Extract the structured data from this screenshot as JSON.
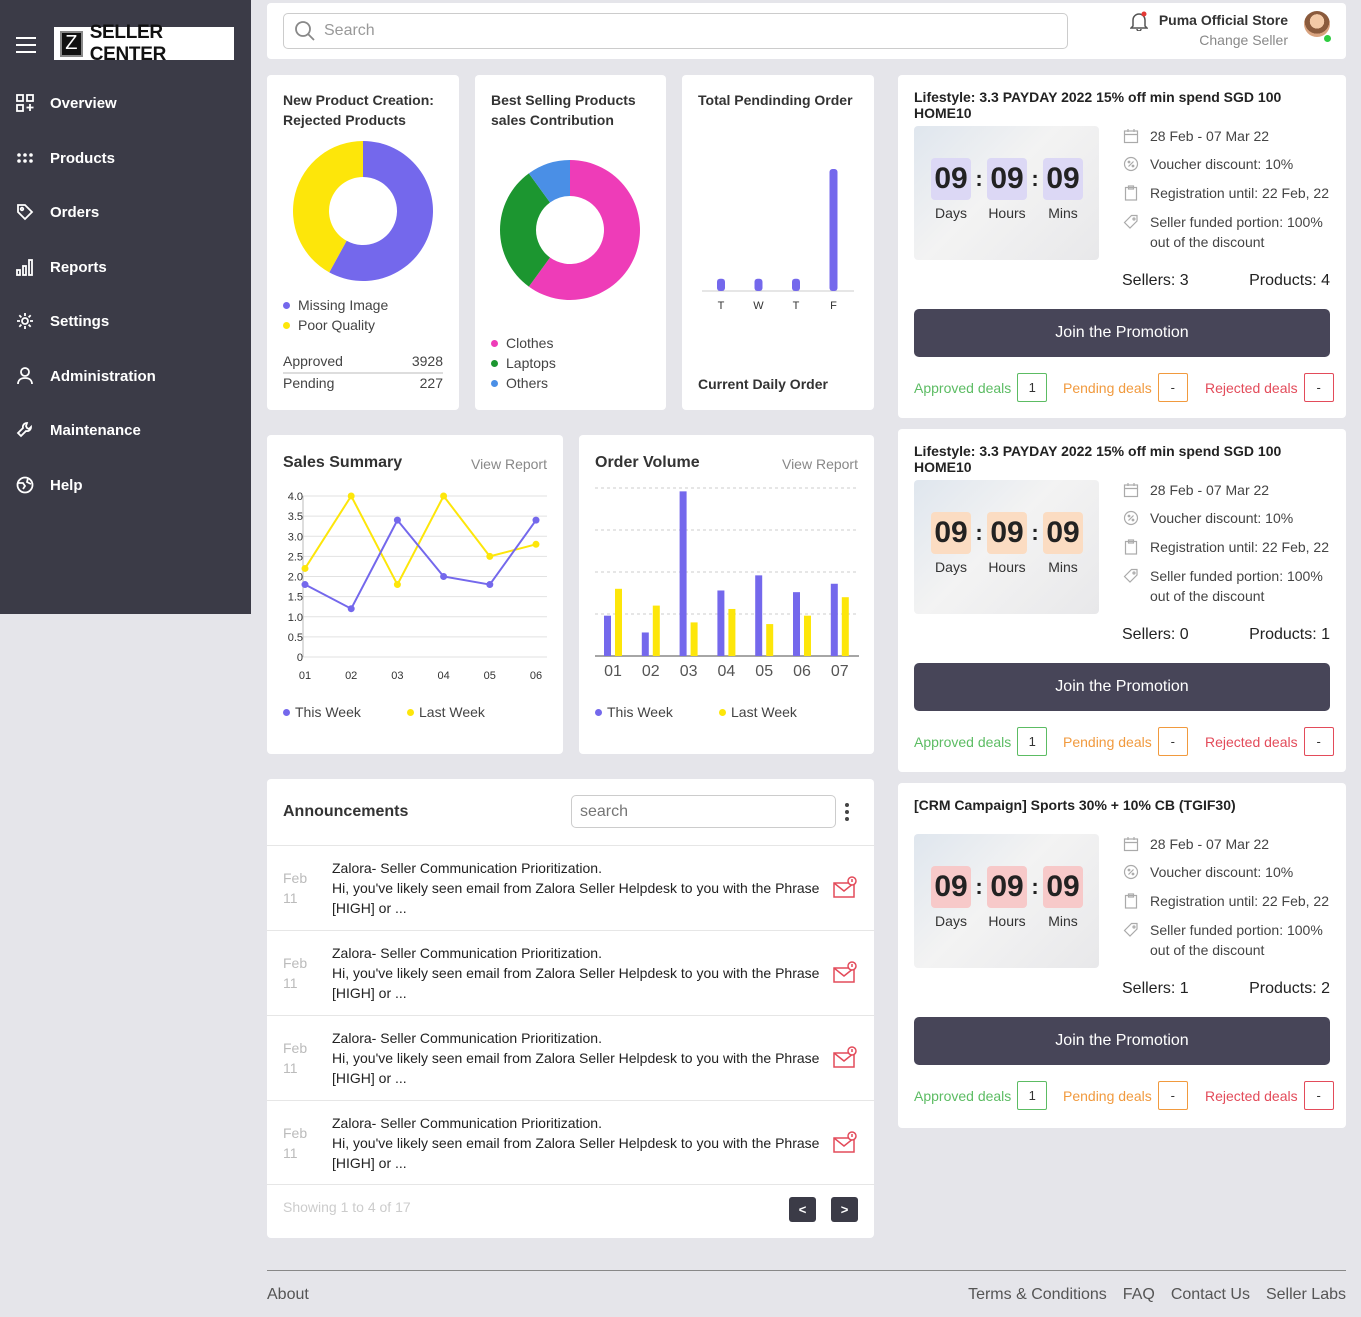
{
  "sidebar": {
    "logo_letter": "Z",
    "logo_text": "SELLER CENTER",
    "items": [
      {
        "label": "Overview",
        "icon": "grid-add-icon"
      },
      {
        "label": "Products",
        "icon": "dots-grid-icon"
      },
      {
        "label": "Orders",
        "icon": "tag-icon"
      },
      {
        "label": "Reports",
        "icon": "bar-chart-icon"
      },
      {
        "label": "Settings",
        "icon": "gear-icon"
      },
      {
        "label": "Administration",
        "icon": "user-icon"
      },
      {
        "label": "Maintenance",
        "icon": "wrench-icon"
      },
      {
        "label": "Help",
        "icon": "globe-icon"
      }
    ]
  },
  "header": {
    "search_placeholder": "Search",
    "store_name": "Puma Official Store",
    "change_seller": "Change Seller"
  },
  "cards": {
    "rejected": {
      "title_line1": "New Product Creation:",
      "title_line2": "Rejected Products",
      "legend": [
        "Missing Image",
        "Poor Quality"
      ],
      "approved_label": "Approved",
      "approved_value": "3928",
      "pending_label": "Pending",
      "pending_value": "227"
    },
    "best_selling": {
      "title_line1": "Best Selling Products",
      "title_line2": "sales Contribution",
      "legend": [
        "Clothes",
        "Laptops",
        "Others"
      ]
    },
    "pending_order": {
      "title": "Total Pendinding Order",
      "footer": "Current Daily Order"
    },
    "sales_summary": {
      "title": "Sales Summary",
      "link": "View Report"
    },
    "order_volume": {
      "title": "Order Volume",
      "link": "View Report"
    },
    "legend_this_week": "This Week",
    "legend_last_week": "Last Week"
  },
  "chart_data": [
    {
      "type": "pie",
      "categories": [
        "Missing Image",
        "Poor Quality"
      ],
      "values": [
        58,
        42
      ],
      "colors": [
        "#7468ec",
        "#fde60a"
      ]
    },
    {
      "type": "pie",
      "categories": [
        "Clothes",
        "Laptops",
        "Others"
      ],
      "values": [
        60,
        30,
        10
      ],
      "colors": [
        "#ee3cb8",
        "#1c9630",
        "#4a8fe6"
      ]
    },
    {
      "type": "bar",
      "categories": [
        "T",
        "W",
        "T",
        "F"
      ],
      "values": [
        1,
        1,
        1,
        10
      ],
      "color": "#7468ec"
    },
    {
      "type": "line",
      "x": [
        "01",
        "02",
        "03",
        "04",
        "05",
        "06"
      ],
      "ylim": [
        0,
        4.0
      ],
      "yticks": [
        "0",
        "0.5",
        "1.0",
        "1.5",
        "2.0",
        "2.5",
        "3.0",
        "3.5",
        "4.0"
      ],
      "series": [
        {
          "name": "This Week",
          "values": [
            1.8,
            1.2,
            3.4,
            2.0,
            1.8,
            3.4
          ],
          "color": "#7468ec"
        },
        {
          "name": "Last Week",
          "values": [
            2.2,
            4.0,
            1.8,
            4.0,
            2.5,
            2.8
          ],
          "color": "#fde60a"
        }
      ]
    },
    {
      "type": "bar",
      "categories": [
        "01",
        "02",
        "03",
        "04",
        "05",
        "06",
        "07"
      ],
      "ylim": [
        0,
        100
      ],
      "series": [
        {
          "name": "This Week",
          "values": [
            24,
            14,
            98,
            39,
            48,
            38,
            43
          ],
          "color": "#7468ec"
        },
        {
          "name": "Last Week",
          "values": [
            40,
            30,
            20,
            28,
            19,
            24,
            35
          ],
          "color": "#fde60a"
        }
      ]
    }
  ],
  "promotions": [
    {
      "title": "Lifestyle: 3.3 PAYDAY 2022 15% off min spend SGD 100 HOME10",
      "countdown": {
        "days": "09",
        "hours": "09",
        "mins": "09"
      },
      "countdown_color": "#dcd8f5",
      "labels": {
        "days": "Days",
        "hours": "Hours",
        "mins": "Mins"
      },
      "date": "28 Feb - 07 Mar 22",
      "voucher": "Voucher discount: 10%",
      "registration": "Registration until: 22 Feb, 22",
      "funded": "Seller funded portion: 100% out of the discount",
      "sellers": "Sellers: 3",
      "products": "Products: 4",
      "join": "Join the Promotion",
      "approved_label": "Approved deals",
      "approved": "1",
      "pending_label": "Pending deals",
      "pending": "-",
      "rejected_label": "Rejected deals",
      "rejected": "-"
    },
    {
      "title": "Lifestyle: 3.3 PAYDAY 2022 15% off min spend SGD 100 HOME10",
      "countdown": {
        "days": "09",
        "hours": "09",
        "mins": "09"
      },
      "countdown_color": "#fbdcc2",
      "labels": {
        "days": "Days",
        "hours": "Hours",
        "mins": "Mins"
      },
      "date": "28 Feb - 07 Mar 22",
      "voucher": "Voucher discount: 10%",
      "registration": "Registration until: 22 Feb, 22",
      "funded": "Seller funded portion: 100% out of the discount",
      "sellers": "Sellers: 0",
      "products": "Products: 1",
      "join": "Join the Promotion",
      "approved_label": "Approved deals",
      "approved": "1",
      "pending_label": "Pending deals",
      "pending": "-",
      "rejected_label": "Rejected deals",
      "rejected": "-"
    },
    {
      "title": "[CRM Campaign] Sports 30% + 10% CB (TGIF30)",
      "countdown": {
        "days": "09",
        "hours": "09",
        "mins": "09"
      },
      "countdown_color": "#f7c9c9",
      "labels": {
        "days": "Days",
        "hours": "Hours",
        "mins": "Mins"
      },
      "date": "28 Feb - 07 Mar 22",
      "voucher": "Voucher discount: 10%",
      "registration": "Registration until: 22 Feb, 22",
      "funded": "Seller funded portion: 100% out of the discount",
      "sellers": "Sellers: 1",
      "products": "Products: 2",
      "join": "Join the Promotion",
      "approved_label": "Approved deals",
      "approved": "1",
      "pending_label": "Pending deals",
      "pending": "-",
      "rejected_label": "Rejected deals",
      "rejected": "-"
    }
  ],
  "announcements": {
    "title": "Announcements",
    "search_placeholder": "search",
    "items": [
      {
        "month": "Feb",
        "day": "11",
        "title": "Zalora- Seller Communication Prioritization.",
        "body": "Hi, you've likely seen email from Zalora Seller Helpdesk to you with the Phrase [HIGH] or ..."
      },
      {
        "month": "Feb",
        "day": "11",
        "title": "Zalora- Seller Communication Prioritization.",
        "body": "Hi, you've likely seen email from Zalora Seller Helpdesk to you with the Phrase [HIGH] or ..."
      },
      {
        "month": "Feb",
        "day": "11",
        "title": "Zalora- Seller Communication Prioritization.",
        "body": "Hi, you've likely seen email from Zalora Seller Helpdesk to you with the Phrase [HIGH] or ..."
      },
      {
        "month": "Feb",
        "day": "11",
        "title": "Zalora- Seller Communication Prioritization.",
        "body": "Hi, you've likely seen email from Zalora Seller Helpdesk to you with the Phrase [HIGH] or ..."
      }
    ],
    "showing": "Showing 1 to 4 of 17",
    "prev": "<",
    "next": ">"
  },
  "footer": {
    "about": "About",
    "terms": "Terms & Conditions",
    "faq": "FAQ",
    "contact": "Contact Us",
    "labs": "Seller Labs"
  }
}
